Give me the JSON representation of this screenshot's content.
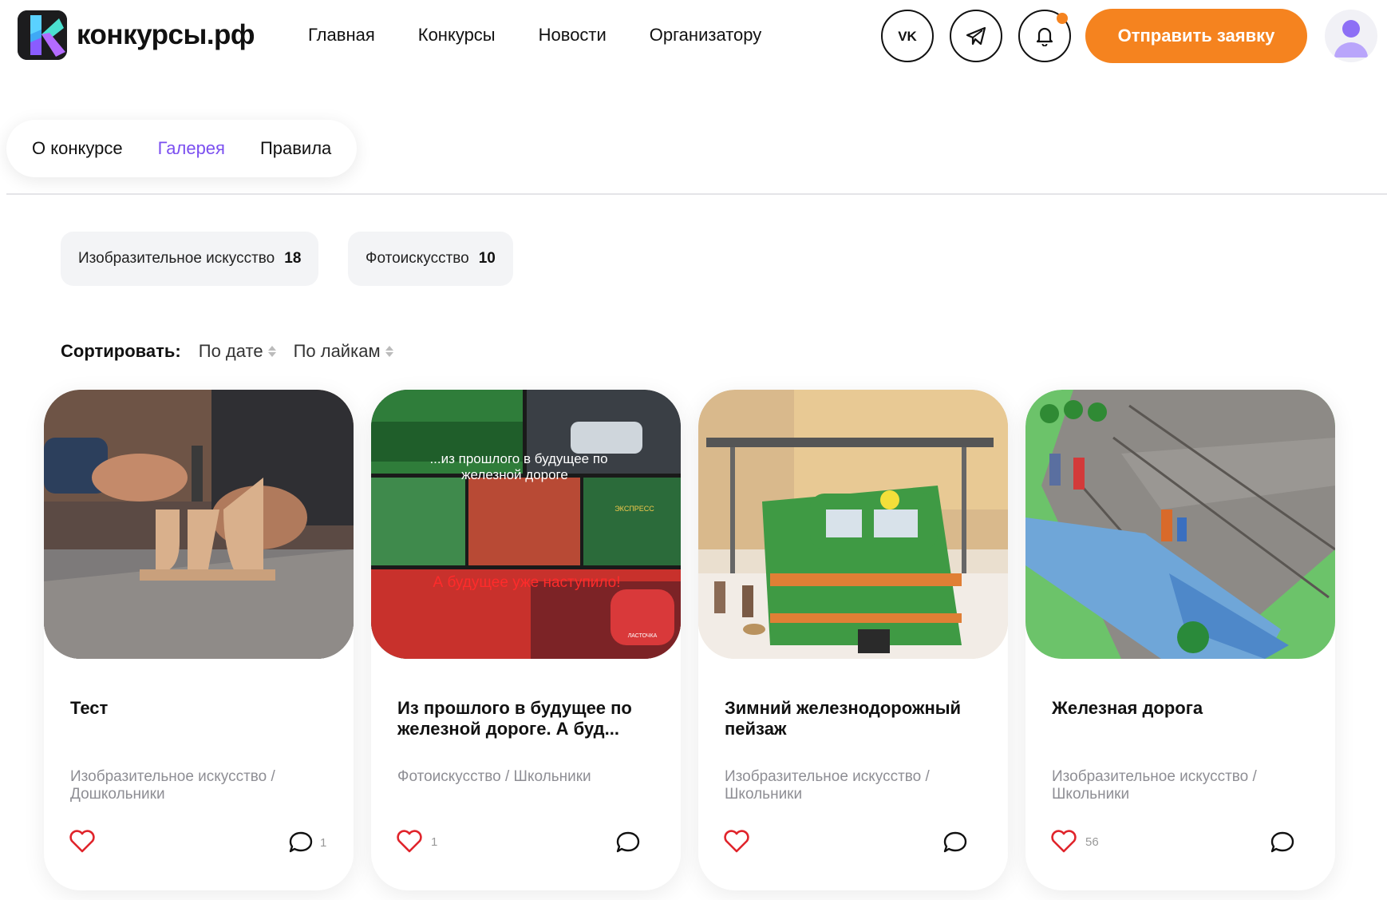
{
  "brand": {
    "name": "конкурсы.рф",
    "accent": "#f5831f",
    "active_tab_color": "#7b4ff0"
  },
  "nav": {
    "items": [
      "Главная",
      "Конкурсы",
      "Новости",
      "Организатору"
    ]
  },
  "header_icons": {
    "vk": "vk-icon",
    "telegram": "telegram-icon",
    "bell": "bell-icon"
  },
  "apply_button": "Отправить заявку",
  "tabs": [
    {
      "label": "О конкурсе",
      "active": false
    },
    {
      "label": "Галерея",
      "active": true
    },
    {
      "label": "Правила",
      "active": false
    }
  ],
  "filters": [
    {
      "label": "Изобразительное искусство",
      "count": "18"
    },
    {
      "label": "Фотоискусство",
      "count": "10"
    }
  ],
  "sort": {
    "label": "Сортировать:",
    "options": [
      "По дате",
      "По лайкам"
    ]
  },
  "cards": [
    {
      "title": "Тест",
      "category": "Изобразительное искусство / Дошкольники",
      "likes": "",
      "comments": "1"
    },
    {
      "title": "Из прошлого в будущее по железной дороге. А буд...",
      "category": "Фотоискусство / Школьники",
      "likes": "1",
      "comments": "",
      "image_text": [
        "...из прошлого в будущее по",
        "железной дороге",
        "А будущее уже наступило!",
        "ЛАСТОЧКА",
        "ЭКСПРЕСС"
      ]
    },
    {
      "title": "Зимний железнодорожный пейзаж",
      "category": "Изобразительное искусство / Школьники",
      "likes": "",
      "comments": ""
    },
    {
      "title": "Железная дорога",
      "category": "Изобразительное искусство / Школьники",
      "likes": "56",
      "comments": ""
    }
  ]
}
